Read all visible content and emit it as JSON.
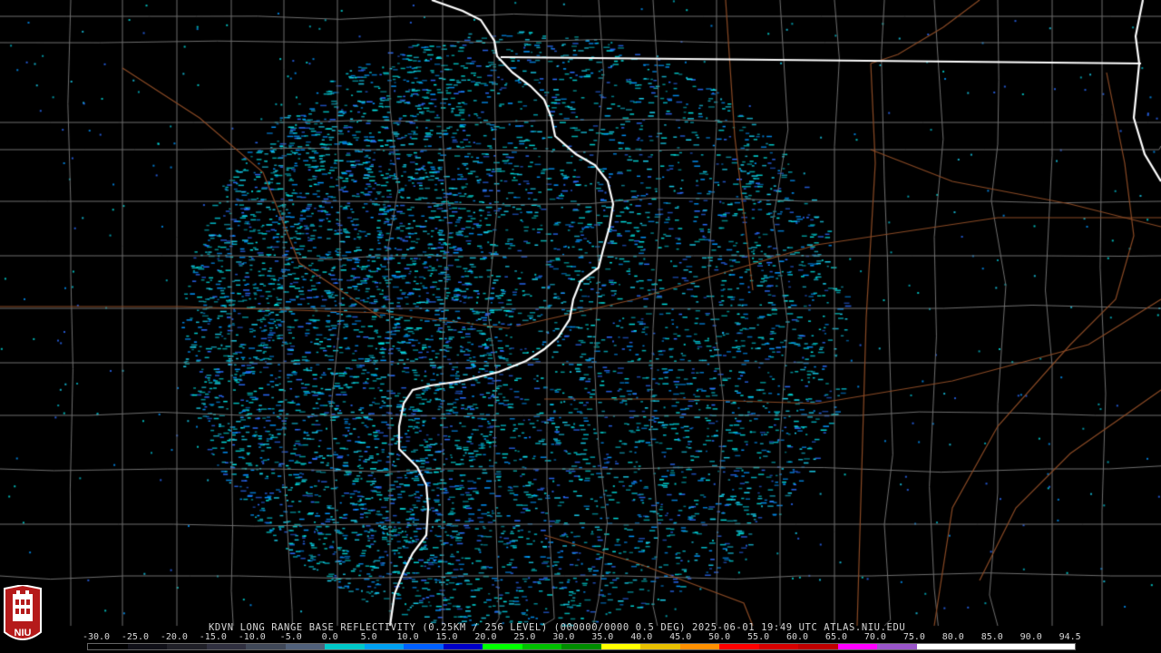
{
  "radar": {
    "product_title": "KDVN LONG RANGE BASE REFLECTIVITY (0.25KM / 256 LEVEL) (000000/0000 0.5 DEG) 2025-06-01 19:49 UTC  ATLAS.NIU.EDU",
    "site": "KDVN",
    "logo_text": "NIU"
  },
  "scale": {
    "ticks": [
      "-30.0",
      "-25.0",
      "-20.0",
      "-15.0",
      "-10.0",
      "-5.0",
      "0.0",
      "5.0",
      "10.0",
      "15.0",
      "20.0",
      "25.0",
      "30.0",
      "35.0",
      "40.0",
      "45.0",
      "50.0",
      "55.0",
      "60.0",
      "65.0",
      "70.0",
      "75.0",
      "80.0",
      "85.0",
      "90.0",
      "94.5"
    ],
    "colors": [
      "#000000",
      "#101018",
      "#202028",
      "#303040",
      "#404858",
      "#50607a",
      "#00c8c8",
      "#00a0f0",
      "#0060ff",
      "#0000c8",
      "#00ff00",
      "#00c000",
      "#008c00",
      "#ffff00",
      "#e7c000",
      "#ff9000",
      "#ff0000",
      "#d60000",
      "#c00000",
      "#ff00ff",
      "#9955c9",
      "#ffffff",
      "#ffffff",
      "#ffffff",
      "#ffffff"
    ],
    "echo_colors": [
      "#00e4e4",
      "#18d2f0",
      "#0096ff",
      "#2a6cff",
      "#00b8c8"
    ],
    "state_border_color": "#ffffff",
    "county_line_color": "#6f6f6f",
    "road_color": "#8a4a25"
  }
}
